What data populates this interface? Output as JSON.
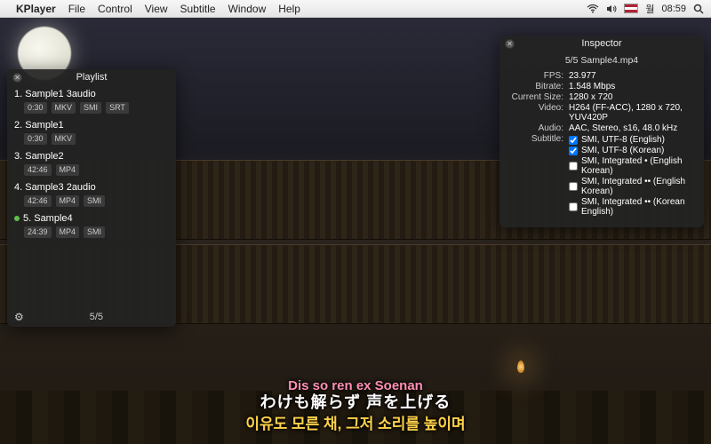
{
  "menubar": {
    "app": "KPlayer",
    "items": [
      "File",
      "Control",
      "View",
      "Subtitle",
      "Window",
      "Help"
    ],
    "day": "월",
    "time": "08:59"
  },
  "playlist": {
    "title": "Playlist",
    "counter": "5/5",
    "items": [
      {
        "idx": "1.",
        "name": "Sample1 3audio",
        "current": false,
        "tags": [
          "0:30",
          "MKV",
          "SMI",
          "SRT"
        ]
      },
      {
        "idx": "2.",
        "name": "Sample1",
        "current": false,
        "tags": [
          "0:30",
          "MKV"
        ]
      },
      {
        "idx": "3.",
        "name": "Sample2",
        "current": false,
        "tags": [
          "42:46",
          "MP4"
        ]
      },
      {
        "idx": "4.",
        "name": "Sample3 2audio",
        "current": false,
        "tags": [
          "42:46",
          "MP4",
          "SMI"
        ]
      },
      {
        "idx": "5.",
        "name": "Sample4",
        "current": true,
        "tags": [
          "24:39",
          "MP4",
          "SMI"
        ]
      }
    ]
  },
  "inspector": {
    "title": "Inspector",
    "subtitle": "5/5  Sample4.mp4",
    "rows": {
      "fps_label": "FPS:",
      "fps": "23.977",
      "bitrate_label": "Bitrate:",
      "bitrate": "1.548 Mbps",
      "size_label": "Current Size:",
      "size": "1280 x 720",
      "video_label": "Video:",
      "video": "H264 (FF-ACC), 1280 x 720, YUV420P",
      "audio_label": "Audio:",
      "audio": "AAC, Stereo, s16, 48.0 kHz",
      "subtitle_label": "Subtitle:"
    },
    "subtitles": [
      {
        "label": "SMI, UTF-8 (English)",
        "checked": true
      },
      {
        "label": "SMI, UTF-8 (Korean)",
        "checked": true
      },
      {
        "label": "SMI, Integrated • (English Korean)",
        "checked": false
      },
      {
        "label": "SMI, Integrated •• (English Korean)",
        "checked": false
      },
      {
        "label": "SMI, Integrated •• (Korean English)",
        "checked": false
      }
    ]
  },
  "subs": {
    "line1": "Dis so ren ex Soenan",
    "line2": "わけも解らず 声を上げる",
    "line3": "이유도 모른 채, 그저 소리를 높이며"
  }
}
